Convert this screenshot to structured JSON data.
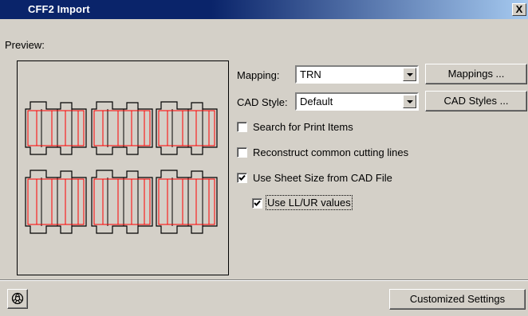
{
  "window": {
    "title": "CFF2 Import",
    "close_glyph": "X"
  },
  "preview": {
    "label": "Preview:"
  },
  "mapping": {
    "label": "Mapping:",
    "value": "TRN",
    "button_label": "Mappings ..."
  },
  "cad_style": {
    "label": "CAD Style:",
    "value": "Default",
    "button_label": "CAD Styles ..."
  },
  "options": [
    {
      "label": "Search for Print Items",
      "checked": false
    },
    {
      "label": "Reconstruct common cutting lines",
      "checked": false
    },
    {
      "label": "Use Sheet Size from CAD File",
      "checked": true
    },
    {
      "label": "Use LL/UR values",
      "checked": true
    }
  ],
  "footer": {
    "help_icon": "lifebuoy-icon",
    "customized_label": "Customized Settings"
  },
  "colors": {
    "outline": "#000000",
    "cut_line": "#ff0000",
    "title_bar": "#0a246a"
  }
}
